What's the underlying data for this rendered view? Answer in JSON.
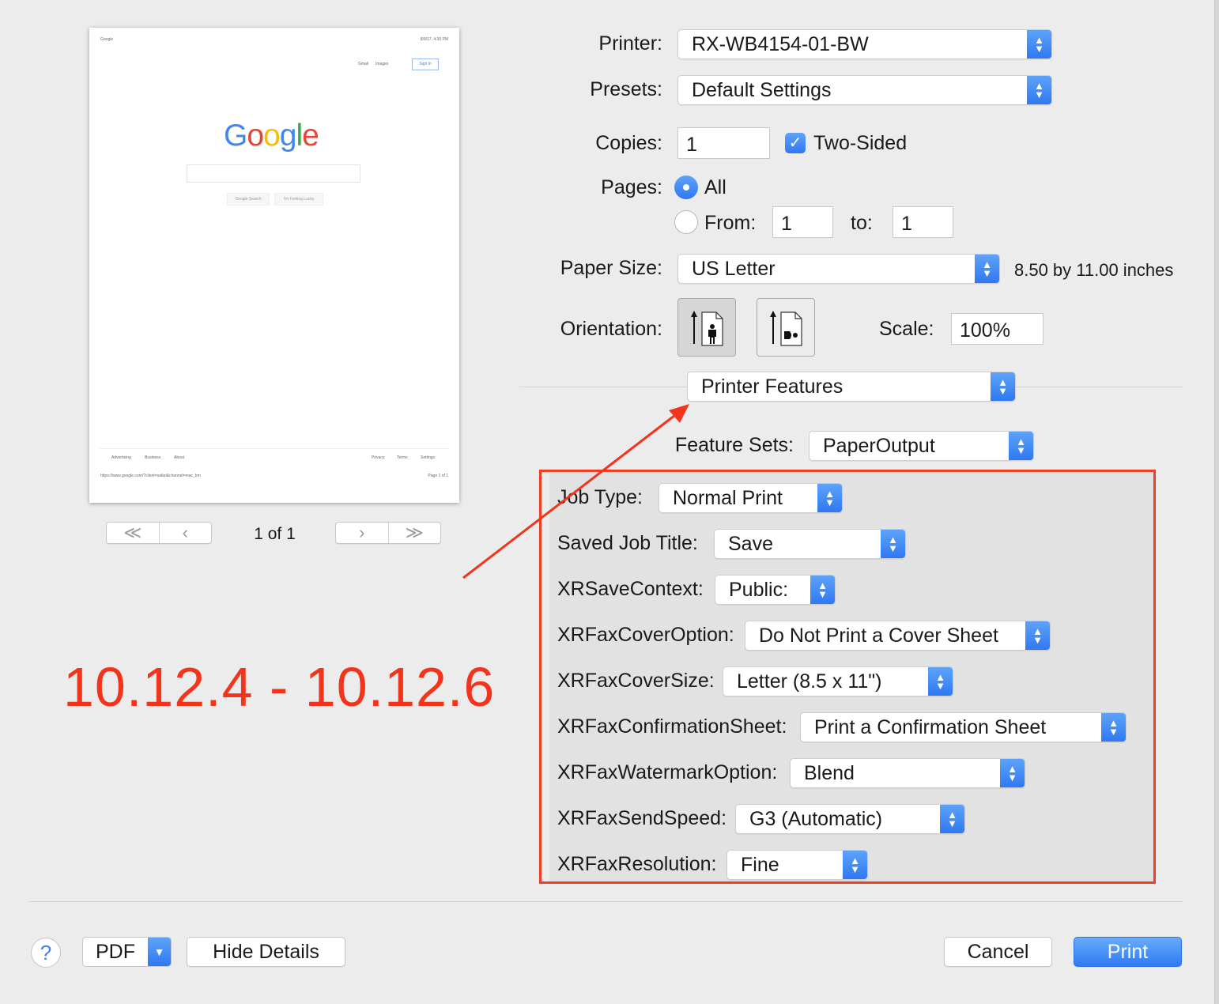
{
  "preview": {
    "header_left": "Google",
    "header_right": "8/9/17, 4:30 PM",
    "top_links": [
      "Gmail",
      "Images"
    ],
    "sign_in": "Sign in",
    "logo_letters": [
      {
        "ch": "G",
        "color": "#4285F4"
      },
      {
        "ch": "o",
        "color": "#EA4335"
      },
      {
        "ch": "o",
        "color": "#FBBC05"
      },
      {
        "ch": "g",
        "color": "#4285F4"
      },
      {
        "ch": "l",
        "color": "#34A853"
      },
      {
        "ch": "e",
        "color": "#EA4335"
      }
    ],
    "search_button": "Google Search",
    "lucky_button": "I'm Feeling Lucky",
    "footer_left": [
      "Advertising",
      "Business",
      "About"
    ],
    "footer_right": [
      "Privacy",
      "Terms",
      "Settings"
    ],
    "url": "https://www.google.com/?client=safari&channel=mac_bm",
    "page_label": "Page 1 of 1",
    "pager": "1 of 1"
  },
  "print": {
    "printer_label": "Printer:",
    "printer_value": "RX-WB4154-01-BW",
    "presets_label": "Presets:",
    "presets_value": "Default Settings",
    "copies_label": "Copies:",
    "copies_value": "1",
    "two_sided_label": "Two-Sided",
    "two_sided_checked": true,
    "pages_label": "Pages:",
    "pages_all_label": "All",
    "pages_from_label": "From:",
    "pages_from_value": "1",
    "pages_to_label": "to:",
    "pages_to_value": "1",
    "paper_size_label": "Paper Size:",
    "paper_size_value": "US Letter",
    "paper_size_dims": "8.50 by 11.00 inches",
    "orientation_label": "Orientation:",
    "scale_label": "Scale:",
    "scale_value": "100%",
    "section_value": "Printer Features",
    "feature_sets_label": "Feature Sets:",
    "feature_sets_value": "PaperOutput"
  },
  "features": [
    {
      "label": "Job Type:",
      "value": "Normal Print"
    },
    {
      "label": "Saved Job Title:",
      "value": "Save"
    },
    {
      "label": "XRSaveContext:",
      "value": "Public:"
    },
    {
      "label": "XRFaxCoverOption:",
      "value": "Do Not Print a Cover Sheet"
    },
    {
      "label": "XRFaxCoverSize:",
      "value": "Letter (8.5 x 11\")"
    },
    {
      "label": "XRFaxConfirmationSheet:",
      "value": "Print a Confirmation Sheet"
    },
    {
      "label": "XRFaxWatermarkOption:",
      "value": "Blend"
    },
    {
      "label": "XRFaxSendSpeed:",
      "value": "G3 (Automatic)"
    },
    {
      "label": "XRFaxResolution:",
      "value": "Fine"
    }
  ],
  "annotation": {
    "text": "10.12.4 - 10.12.6",
    "color": "#f2341c"
  },
  "footer": {
    "help": "?",
    "pdf": "PDF",
    "hide_details": "Hide Details",
    "cancel": "Cancel",
    "print": "Print"
  },
  "colors": {
    "accent": "#2f7bf3",
    "annotation_red": "#f2341c"
  }
}
